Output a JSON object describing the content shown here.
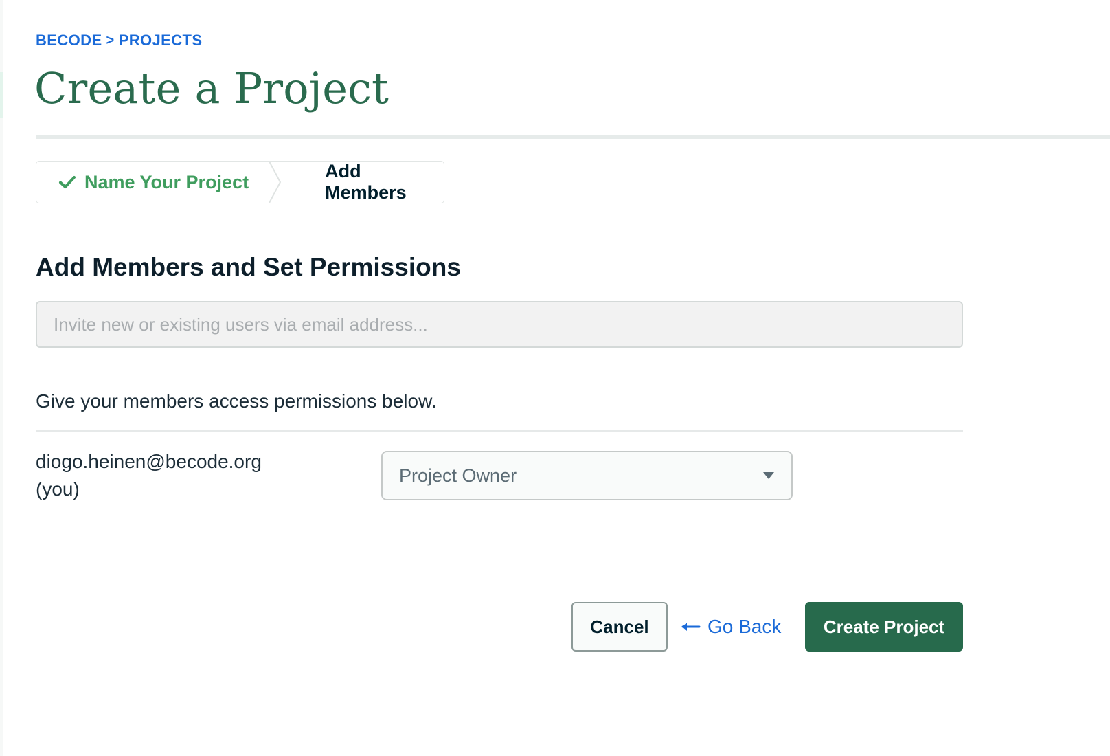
{
  "breadcrumb": {
    "items": [
      "BECODE",
      "PROJECTS"
    ],
    "separator": ">"
  },
  "page": {
    "title": "Create a Project"
  },
  "stepper": {
    "steps": [
      {
        "label": "Name Your Project",
        "status": "complete",
        "icon": "check-icon"
      },
      {
        "label": "Add Members",
        "status": "current"
      }
    ]
  },
  "section": {
    "heading": "Add Members and Set Permissions",
    "invite_placeholder": "Invite new or existing users via email address...",
    "invite_value": "",
    "help_text": "Give your members access permissions below."
  },
  "members": [
    {
      "email": "diogo.heinen@becode.org",
      "note": "(you)",
      "role": "Project Owner"
    }
  ],
  "actions": {
    "cancel_label": "Cancel",
    "go_back_label": "Go Back",
    "create_label": "Create Project"
  },
  "colors": {
    "brand_green": "#276a4c",
    "title_green": "#2a6b4e",
    "step_complete": "#3f9d5e",
    "link_blue": "#1a6ad8",
    "text_dark": "#001e2b"
  },
  "icons": {
    "step_complete": "check-icon",
    "role_dropdown": "caret-down-icon",
    "go_back": "arrow-left-icon"
  }
}
